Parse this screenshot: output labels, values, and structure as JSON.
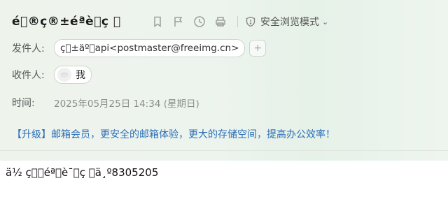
{
  "email": {
    "subject": "é\u0000®ç®±éªè\u0000ç \u0000",
    "toolbar": {
      "icons": [
        "bookmark-icon",
        "flag-icon",
        "clock-icon",
        "print-icon"
      ],
      "safe_mode_label": "安全浏览模式",
      "safe_mode_chevron": "⌄"
    },
    "sender": {
      "label": "发件人:",
      "display": "ç\u0000±äº\u0000api<postmaster@freeimg.cn>",
      "add_symbol": "+"
    },
    "recipient": {
      "label": "收件人:",
      "name": "我"
    },
    "time": {
      "label": "时间:",
      "value": "2025年05月25日 14:34 (星期日)"
    },
    "promo_text": "【升级】邮箱会员，更安全的邮箱体验，更大的存储空间，提高办公效率！",
    "body": "ä½ ç\u0000\u0000éª\u0000è¯\u0000ç \u0000ä¸º8305205"
  }
}
